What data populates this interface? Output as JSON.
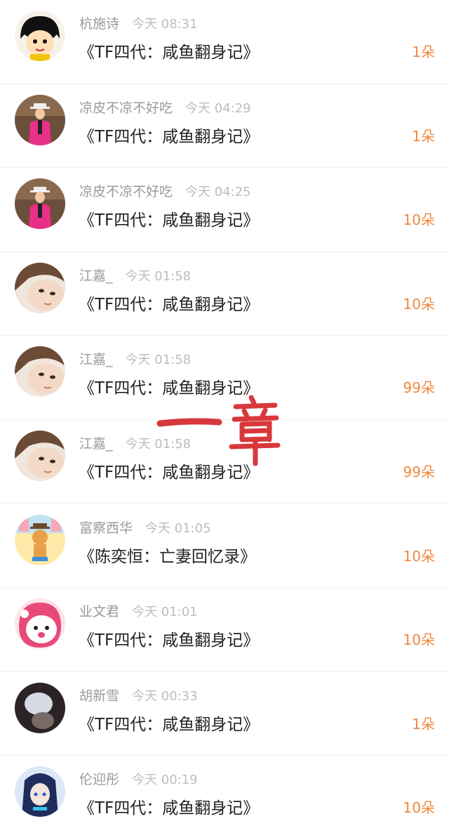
{
  "list": {
    "items": [
      {
        "user": "杭施诗",
        "time": "今天 08:31",
        "book": "《TF四代：咸鱼翻身记》",
        "count": "1朵",
        "avatar_icon": "cartoon-girl-avatar"
      },
      {
        "user": "凉皮不凉不好吃",
        "time": "今天 04:29",
        "book": "《TF四代：咸鱼翻身记》",
        "count": "1朵",
        "avatar_icon": "performer-pink-suit-avatar"
      },
      {
        "user": "凉皮不凉不好吃",
        "time": "今天 04:25",
        "book": "《TF四代：咸鱼翻身记》",
        "count": "10朵",
        "avatar_icon": "performer-pink-suit-avatar"
      },
      {
        "user": "江嘉_",
        "time": "今天 01:58",
        "book": "《TF四代：咸鱼翻身记》",
        "count": "10朵",
        "avatar_icon": "girl-selfie-avatar"
      },
      {
        "user": "江嘉_",
        "time": "今天 01:58",
        "book": "《TF四代：咸鱼翻身记》",
        "count": "99朵",
        "avatar_icon": "girl-selfie-avatar"
      },
      {
        "user": "江嘉_",
        "time": "今天 01:58",
        "book": "《TF四代：咸鱼翻身记》",
        "count": "99朵",
        "avatar_icon": "girl-selfie-avatar"
      },
      {
        "user": "富察西华",
        "time": "今天 01:05",
        "book": "《陈奕恒：亡妻回忆录》",
        "count": "10朵",
        "avatar_icon": "cartoon-bear-avatar"
      },
      {
        "user": "业文君",
        "time": "今天 01:01",
        "book": "《TF四代：咸鱼翻身记》",
        "count": "10朵",
        "avatar_icon": "cartoon-pink-hood-avatar"
      },
      {
        "user": "胡新雪",
        "time": "今天 00:33",
        "book": "《TF四代：咸鱼翻身记》",
        "count": "1朵",
        "avatar_icon": "dark-photo-avatar"
      },
      {
        "user": "伦迎彤",
        "time": "今天 00:19",
        "book": "《TF四代：咸鱼翻身记》",
        "count": "10朵",
        "avatar_icon": "anime-blue-avatar"
      }
    ]
  },
  "annotation": {
    "text": "一 章",
    "color": "#d8383c"
  },
  "colors": {
    "count": "#f0883a",
    "username": "#9a9a9a",
    "time": "#bdbdbd",
    "title": "#222222"
  }
}
